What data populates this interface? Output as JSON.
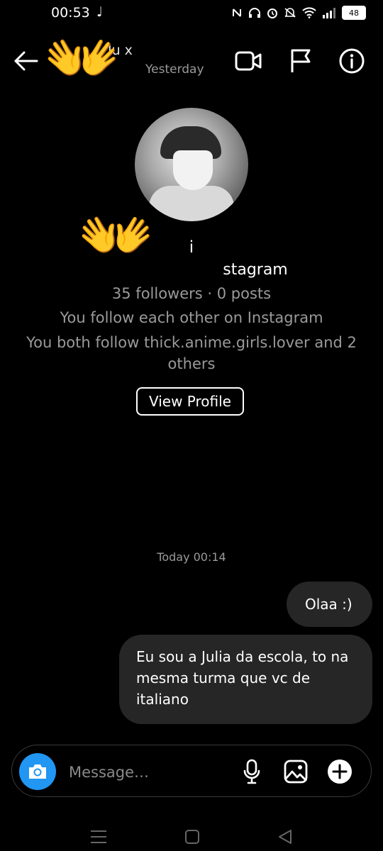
{
  "status_bar": {
    "time": "00:53",
    "music_icon": "music-note-icon",
    "battery": "48"
  },
  "header": {
    "name": "Ju x",
    "subtitle": "Yesterday",
    "icons": [
      "arrow-left-icon",
      "video-camera-icon",
      "flag-icon",
      "info-icon"
    ]
  },
  "profile": {
    "name": "i",
    "handle_partial": "stagram",
    "stats": "35 followers · 0 posts",
    "mutual_text": "You follow each other on Instagram",
    "both_follow_text": "You both follow thick.anime.girls.lover and 2 others",
    "view_profile_label": "View Profile"
  },
  "chat": {
    "timestamp": "Today 00:14",
    "messages": [
      {
        "sender": "me",
        "text": "Olaa :)"
      },
      {
        "sender": "me",
        "text": "Eu sou a Julia da escola, to na mesma turma que vc de italiano"
      }
    ]
  },
  "composer": {
    "placeholder": "Message…"
  },
  "emoji_covers": [
    "👐",
    "👐"
  ],
  "colors": {
    "background": "#000000",
    "bubble": "#262626",
    "accent": "#2196f3",
    "muted_text": "#9a9a9a"
  }
}
